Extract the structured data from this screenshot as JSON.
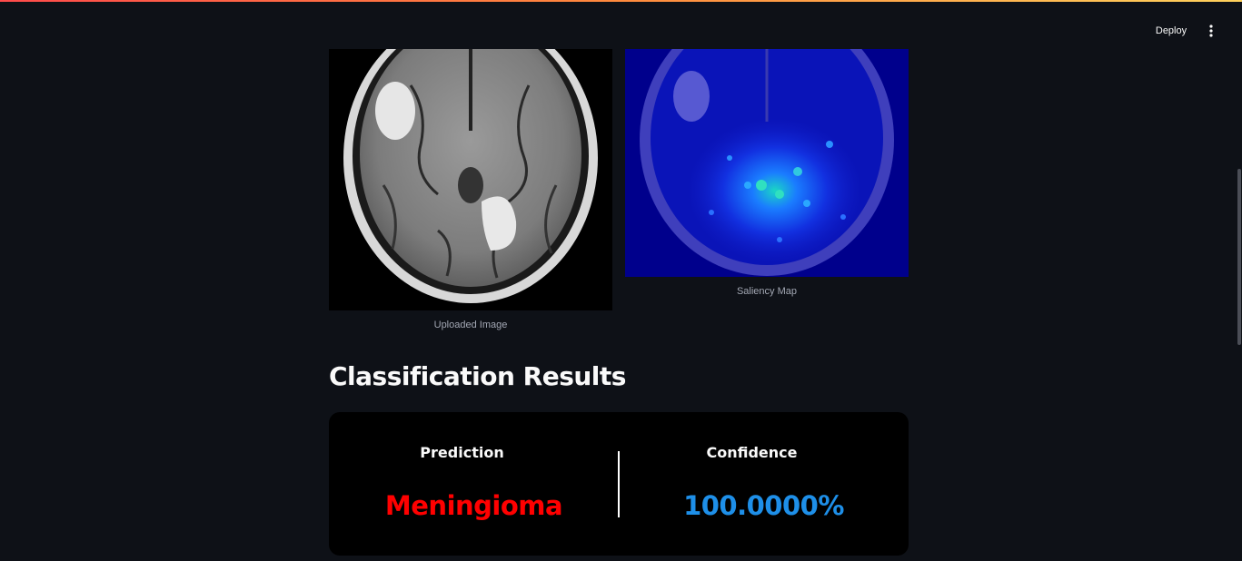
{
  "header": {
    "deploy_label": "Deploy",
    "menu_icon": "vertical-ellipsis-icon"
  },
  "images": {
    "uploaded_caption": "Uploaded Image",
    "saliency_caption": "Saliency Map"
  },
  "results": {
    "title": "Classification Results",
    "prediction_label": "Prediction",
    "prediction_value": "Meningioma",
    "confidence_label": "Confidence",
    "confidence_value": "100.0000%"
  },
  "colors": {
    "background": "#0e1117",
    "card": "#000000",
    "prediction": "#ff0000",
    "confidence": "#1e8fe8"
  }
}
